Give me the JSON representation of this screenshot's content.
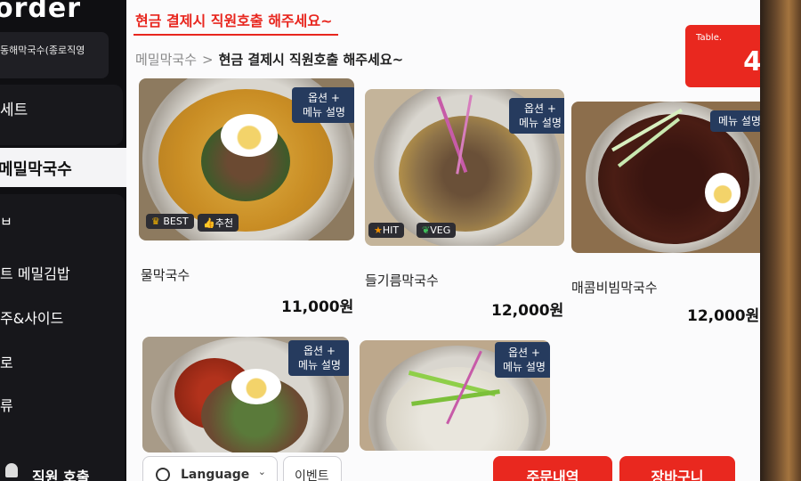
{
  "sidebar": {
    "logo": "order",
    "store_name": "동해막국수(종로직영",
    "items": [
      {
        "label": "세트"
      },
      {
        "label": "메밀막국수",
        "active": true
      },
      {
        "label": "ㅂ"
      },
      {
        "label": "트 메밀김밥"
      },
      {
        "label": "주&사이드"
      },
      {
        "label": "로"
      },
      {
        "label": "류"
      }
    ],
    "staff_call": "직원 호출"
  },
  "header": {
    "notice": "현금 결제시 직원호출 해주세요~",
    "breadcrumb_root": "메밀막국수",
    "breadcrumb_sep": ">",
    "breadcrumb_current": "현금 결제시 직원호출 해주세요~",
    "table_label": "Table.",
    "table_number": "4"
  },
  "menu": [
    {
      "name": "물막국수",
      "price": "11,000원",
      "option_tag": "옵션 +\n메뉴 설명",
      "badges": [
        "BEST",
        "추천"
      ]
    },
    {
      "name": "들기름막국수",
      "price": "12,000원",
      "option_tag": "옵션 +\n메뉴 설명",
      "badges": [
        "HIT",
        "VEG"
      ]
    },
    {
      "name": "매콤비빔막국수",
      "price": "12,000원",
      "option_tag": "메뉴 설명",
      "badges": []
    },
    {
      "name": "",
      "price": "",
      "option_tag": "옵션 +\n메뉴 설명",
      "badges": []
    },
    {
      "name": "",
      "price": "",
      "option_tag": "옵션 +\n메뉴 설명",
      "badges": []
    }
  ],
  "footer": {
    "language": "Language",
    "event": "이벤트",
    "order_history": "주문내역",
    "cart": "장바구니"
  },
  "colors": {
    "accent": "#e9281f",
    "tag_bg": "#263b5e",
    "sidebar_bg": "#0f0f12"
  },
  "icons": [
    "globe-icon",
    "chevron-down-icon",
    "bell-icon",
    "crown-icon",
    "thumbs-up-icon",
    "star-icon",
    "leaf-icon"
  ]
}
